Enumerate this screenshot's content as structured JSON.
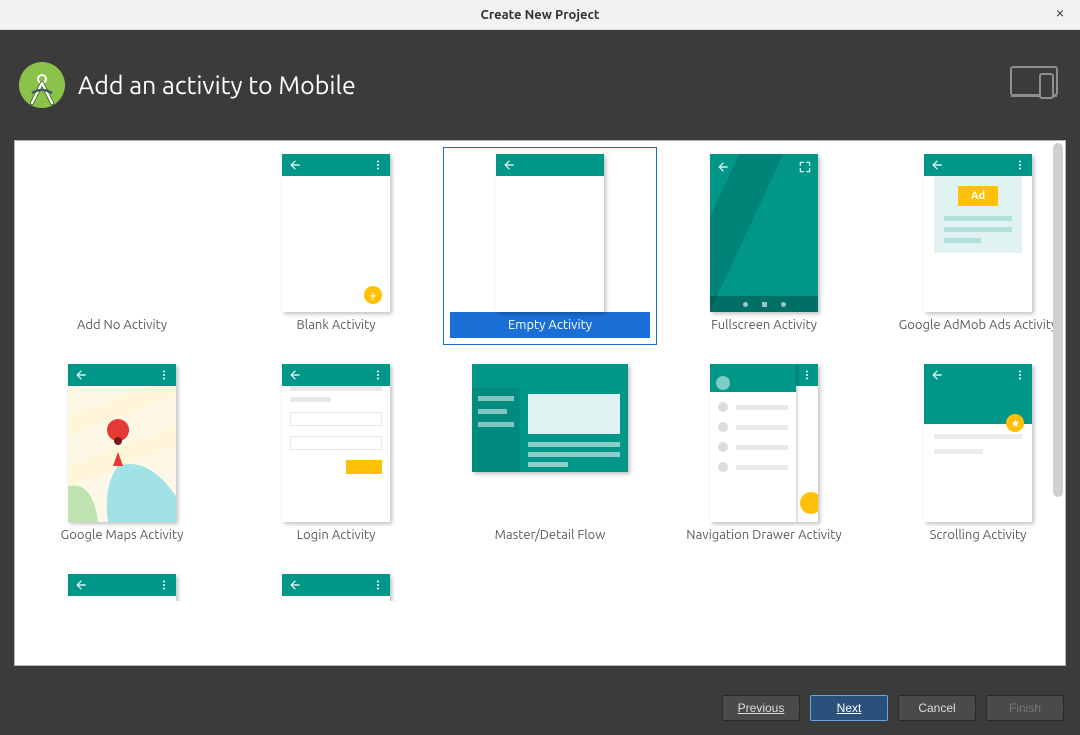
{
  "window": {
    "title": "Create New Project"
  },
  "header": {
    "title": "Add an activity to Mobile"
  },
  "gallery": {
    "selected_index": 2,
    "items": [
      {
        "label": "Add No Activity"
      },
      {
        "label": "Blank Activity"
      },
      {
        "label": "Empty Activity"
      },
      {
        "label": "Fullscreen Activity"
      },
      {
        "label": "Google AdMob Ads Activity",
        "ad_text": "Ad"
      },
      {
        "label": "Google Maps Activity"
      },
      {
        "label": "Login Activity"
      },
      {
        "label": "Master/Detail Flow"
      },
      {
        "label": "Navigation Drawer Activity"
      },
      {
        "label": "Scrolling Activity"
      }
    ]
  },
  "footer": {
    "previous": "Previous",
    "next": "Next",
    "cancel": "Cancel",
    "finish": "Finish"
  }
}
